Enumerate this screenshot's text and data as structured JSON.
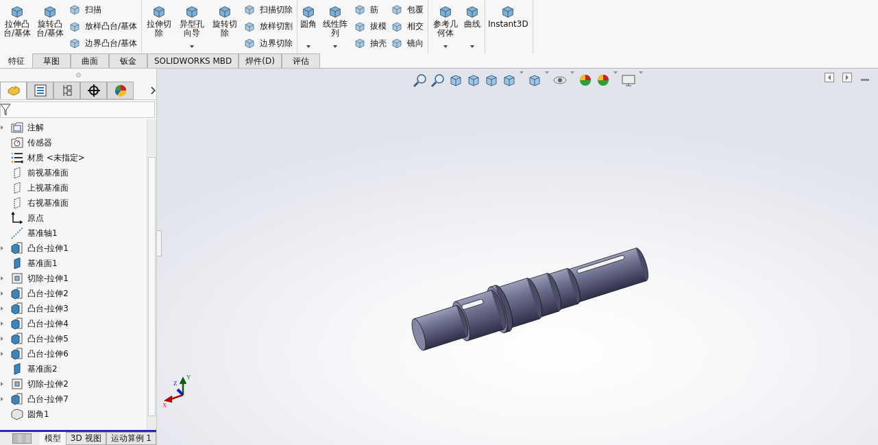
{
  "ribbon": [
    {
      "columns": [
        {
          "kind": "large",
          "label": "拉伸凸台/基体",
          "dropdown": false
        },
        {
          "kind": "large",
          "label": "旋转凸台/基体",
          "dropdown": false
        },
        {
          "kind": "stack",
          "items": [
            "扫描",
            "放样凸台/基体",
            "边界凸台/基体"
          ]
        }
      ]
    },
    {
      "columns": [
        {
          "kind": "large",
          "label": "拉伸切除",
          "dropdown": false
        },
        {
          "kind": "large",
          "label": "异型孔向导",
          "dropdown": true
        },
        {
          "kind": "large",
          "label": "旋转切除",
          "dropdown": false
        },
        {
          "kind": "stack",
          "items": [
            "扫描切除",
            "放样切割",
            "边界切除"
          ]
        }
      ]
    },
    {
      "columns": [
        {
          "kind": "large",
          "label": "圆角",
          "dropdown": true
        },
        {
          "kind": "large",
          "label": "线性阵列",
          "dropdown": true
        },
        {
          "kind": "stack",
          "items": [
            "筋",
            "拔模",
            "抽壳"
          ]
        },
        {
          "kind": "stack",
          "items": [
            "包覆",
            "相交",
            "镜向"
          ]
        }
      ]
    },
    {
      "columns": [
        {
          "kind": "large",
          "label": "参考几何体",
          "dropdown": true
        },
        {
          "kind": "large",
          "label": "曲线",
          "dropdown": true
        }
      ]
    },
    {
      "columns": [
        {
          "kind": "large",
          "label": "Instant3D",
          "dropdown": false
        }
      ]
    }
  ],
  "command_tabs": [
    {
      "label": "特征",
      "selected": true
    },
    {
      "label": "草图",
      "selected": false
    },
    {
      "label": "曲面",
      "selected": false
    },
    {
      "label": "钣金",
      "selected": false
    },
    {
      "label": "SOLIDWORKS MBD",
      "selected": false
    },
    {
      "label": "焊件(D)",
      "selected": false
    },
    {
      "label": "评估",
      "selected": false
    }
  ],
  "panel_tabs": [
    {
      "selected": true
    },
    {
      "selected": false
    },
    {
      "selected": false
    },
    {
      "selected": false
    },
    {
      "selected": false
    }
  ],
  "tree": [
    {
      "label": "注解",
      "kind": "annotations",
      "has_children": true
    },
    {
      "label": "传感器",
      "kind": "sensors",
      "has_children": false
    },
    {
      "label": "材质 <未指定>",
      "kind": "material",
      "has_children": false
    },
    {
      "label": "前视基准面",
      "kind": "plane",
      "has_children": false
    },
    {
      "label": "上视基准面",
      "kind": "plane",
      "has_children": false
    },
    {
      "label": "右视基准面",
      "kind": "plane",
      "has_children": false
    },
    {
      "label": "原点",
      "kind": "origin",
      "has_children": false
    },
    {
      "label": "基准轴1",
      "kind": "axis",
      "has_children": false
    },
    {
      "label": "凸台-拉伸1",
      "kind": "boss",
      "has_children": true
    },
    {
      "label": "基准面1",
      "kind": "refplane",
      "has_children": false
    },
    {
      "label": "切除-拉伸1",
      "kind": "cut",
      "has_children": true
    },
    {
      "label": "凸台-拉伸2",
      "kind": "boss",
      "has_children": true
    },
    {
      "label": "凸台-拉伸3",
      "kind": "boss",
      "has_children": true
    },
    {
      "label": "凸台-拉伸4",
      "kind": "boss",
      "has_children": true
    },
    {
      "label": "凸台-拉伸5",
      "kind": "boss",
      "has_children": true
    },
    {
      "label": "凸台-拉伸6",
      "kind": "boss",
      "has_children": true
    },
    {
      "label": "基准面2",
      "kind": "refplane",
      "has_children": false
    },
    {
      "label": "切除-拉伸2",
      "kind": "cut",
      "has_children": true
    },
    {
      "label": "凸台-拉伸7",
      "kind": "boss",
      "has_children": true
    },
    {
      "label": "圆角1",
      "kind": "fillet",
      "has_children": false
    }
  ],
  "view_toolbar": [
    {
      "kind": "zoom-fit",
      "dropdown": false
    },
    {
      "kind": "zoom-area",
      "dropdown": false
    },
    {
      "kind": "previous",
      "dropdown": false
    },
    {
      "kind": "section",
      "dropdown": false
    },
    {
      "kind": "annotation",
      "dropdown": false
    },
    {
      "kind": "orientation",
      "dropdown": true
    },
    {
      "kind": "display-style",
      "dropdown": true
    },
    {
      "kind": "visibility",
      "dropdown": true
    },
    {
      "kind": "appearance",
      "dropdown": false
    },
    {
      "kind": "scene",
      "dropdown": true
    },
    {
      "kind": "display",
      "dropdown": true
    }
  ],
  "triad": {
    "x": "X",
    "y": "Y",
    "z": "Z"
  },
  "bottom_tabs": [
    {
      "label": "模型",
      "selected": true
    },
    {
      "label": "3D 视图",
      "selected": false
    },
    {
      "label": "运动算例 1",
      "selected": false
    }
  ]
}
